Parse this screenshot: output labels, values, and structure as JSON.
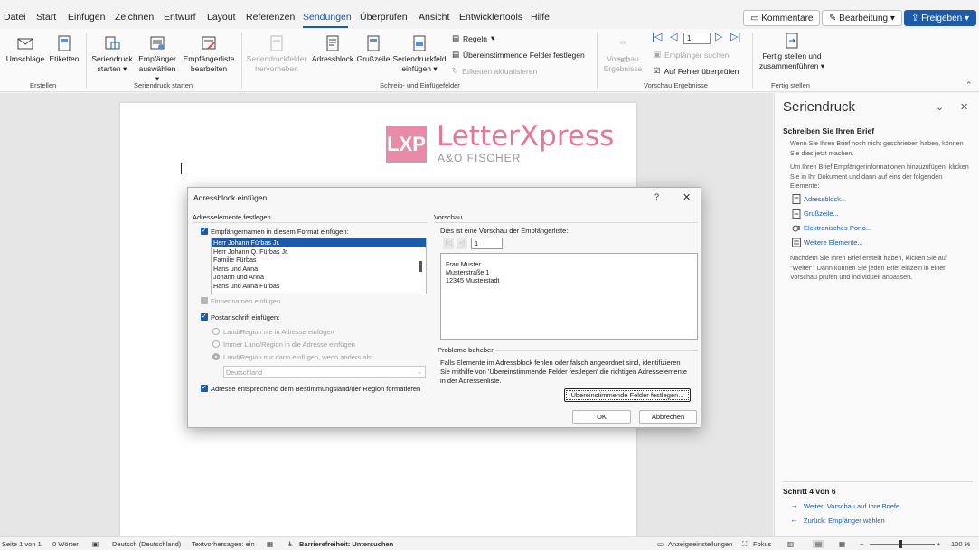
{
  "menu": {
    "tabs": [
      "Datei",
      "Start",
      "Einfügen",
      "Zeichnen",
      "Entwurf",
      "Layout",
      "Referenzen",
      "Sendungen",
      "Überprüfen",
      "Ansicht",
      "Entwicklertools",
      "Hilfe"
    ],
    "active": "Sendungen",
    "comments": "Kommentare",
    "editing": "Bearbeitung",
    "share": "Freigeben"
  },
  "ribbon": {
    "erstellen": {
      "label": "Erstellen",
      "umschlaege": "Umschläge",
      "etiketten": "Etiketten"
    },
    "start": {
      "label": "Seriendruck starten",
      "seriendruck_1": "Seriendruck",
      "seriendruck_2": "starten",
      "empfaenger_1": "Empfänger",
      "empfaenger_2": "auswählen",
      "liste_1": "Empfängerliste",
      "liste_2": "bearbeiten"
    },
    "felder": {
      "label": "Schreib- und Einfügefelder",
      "hervor_1": "Seriendruckfelder",
      "hervor_2": "hervorheben",
      "adressblock": "Adressblock",
      "grusszeile": "Grußzeile",
      "feld_1": "Seriendruckfeld",
      "feld_2": "einfügen",
      "regeln": "Regeln",
      "felder_festlegen": "Übereinstimmende Felder festlegen",
      "etiketten_aktual": "Etiketten aktualisieren"
    },
    "vorschau": {
      "label": "Vorschau Ergebnisse",
      "btn_1": "Vorschau",
      "btn_2": "Ergebnisse",
      "record": "1",
      "empfaenger_suchen": "Empfänger suchen",
      "fehler": "Auf Fehler überprüfen"
    },
    "fertig": {
      "label": "Fertig stellen",
      "btn_1": "Fertig stellen und",
      "btn_2": "zusammenführen"
    }
  },
  "logo": {
    "mark": "LXP",
    "name": "LetterXpress",
    "sub": "A&O FISCHER"
  },
  "pane": {
    "title": "Seriendruck",
    "heading": "Schreiben Sie Ihren Brief",
    "p1": "Wenn Sie Ihren Brief noch nicht geschrieben haben, können Sie dies jetzt machen.",
    "p2": "Um Ihren Brief Empfängerinformationen hinzuzufügen, klicken Sie in Ihr Dokument und dann auf eins der folgenden Elemente:",
    "links": [
      "Adressblock...",
      "Grußzeile...",
      "Elektronisches Porto...",
      "Weitere Elemente..."
    ],
    "p3": "Nachdem Sie Ihren Brief erstellt haben, klicken Sie auf \"Weiter\". Dann können Sie jeden Brief einzeln in einer Vorschau prüfen und individuell anpassen.",
    "step": "Schritt 4 von 6",
    "next": "Weiter: Vorschau auf Ihre Briefe",
    "back": "Zurück: Empfänger wählen"
  },
  "dialog": {
    "title": "Adressblock einfügen",
    "help": "?",
    "left_heading": "Adresselemente festlegen",
    "name_format_label": "Empfängernamen in diesem Format einfügen:",
    "name_formats": [
      "Herr Johann Fürbas Jr.",
      "Herr Johann Q. Fürbas Jr.",
      "Familie Fürbas",
      "Hans und Anna",
      "Johann und Anna",
      "Hans und Anna Fürbas"
    ],
    "firmenname": "Firmennamen einfügen",
    "postanschrift": "Postanschrift einfügen:",
    "radio_1": "Land/Region nie in Adresse einfügen",
    "radio_2": "Immer Land/Region in die Adresse einfügen",
    "radio_3": "Land/Region nur dann einfügen, wenn anders als:",
    "country": "Deutschland",
    "format_land": "Adresse entsprechend dem Bestimmungsland/der Region formatieren",
    "right_heading": "Vorschau",
    "preview_label": "Dies ist eine Vorschau der Empfängerliste:",
    "preview_record": "1",
    "preview_lines": [
      "Frau Muster",
      "Musterstraße 1",
      "12345 Musterstadt"
    ],
    "problems_heading": "Probleme beheben",
    "problems_text_1": "Falls Elemente im Adressblock fehlen oder falsch angeordnet sind, identifizieren",
    "problems_text_2": "Sie mithilfe von 'Übereinstimmende Felder festlegen' die richtigen Adresselemente",
    "problems_text_3": "in der Adressenliste.",
    "match_btn": "Übereinstimmende Felder festlegen...",
    "ok": "OK",
    "cancel": "Abbrechen"
  },
  "status": {
    "page": "Seite 1 von 1",
    "words": "0 Wörter",
    "lang": "Deutsch (Deutschland)",
    "predict": "Textvorhersagen: ein",
    "access": "Barrierefreiheit: Untersuchen",
    "display": "Anzeigeeinstellungen",
    "focus": "Fokus",
    "zoom": "100 %"
  }
}
